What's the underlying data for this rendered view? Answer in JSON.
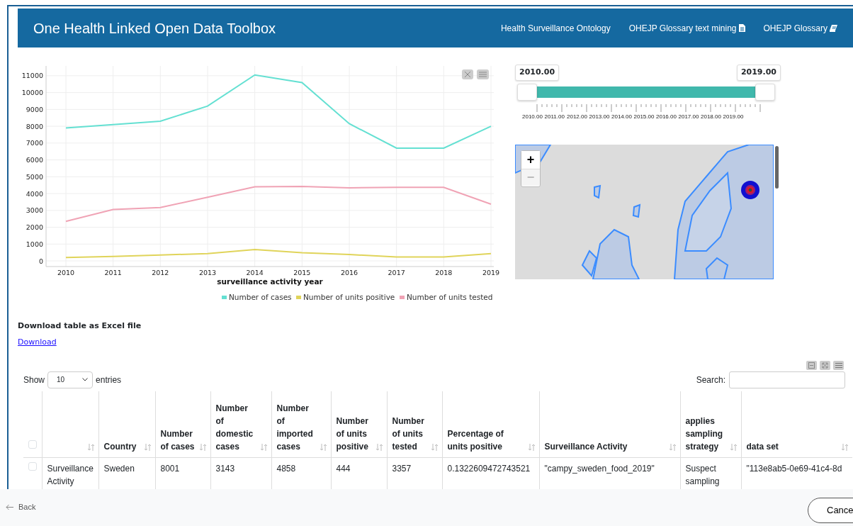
{
  "header": {
    "title": "One Health Linked Open Data Toolbox",
    "links": [
      {
        "label": "Health Surveillance Ontology",
        "kind": "plain"
      },
      {
        "label": "OHEJP Glossary text mining",
        "kind": "document"
      },
      {
        "label": "OHEJP Glossary",
        "kind": "book"
      }
    ]
  },
  "chart": {
    "chart_data": {
      "type": "line",
      "xlabel": "surveillance activity year",
      "grid": true,
      "legend": true,
      "categories": [
        "2010",
        "2011",
        "2012",
        "2013",
        "2014",
        "2015",
        "2016",
        "2017",
        "2018",
        "2019"
      ],
      "yticks": [
        0,
        1000,
        2000,
        3000,
        4000,
        5000,
        6000,
        7000,
        8000,
        9000,
        10000,
        11000
      ],
      "ylim": [
        0,
        11500
      ],
      "series": [
        {
          "name": "Number of cases",
          "color": "#64e0d2",
          "values": [
            7900,
            8100,
            8300,
            9200,
            11050,
            10600,
            8150,
            6700,
            6700,
            8000
          ]
        },
        {
          "name": "Number of units positive",
          "color": "#e0d45a",
          "values": [
            200,
            260,
            350,
            430,
            680,
            480,
            380,
            230,
            230,
            430
          ]
        },
        {
          "name": "Number of units tested",
          "color": "#f0a3b5",
          "values": [
            2350,
            3050,
            3170,
            3780,
            4400,
            4420,
            4340,
            4370,
            4370,
            3370
          ]
        }
      ]
    }
  },
  "slider": {
    "start": {
      "label": "2010.00"
    },
    "end": {
      "label": "2019.00"
    },
    "tick_labels": [
      "2010.00",
      "2011.00",
      "2012.00",
      "2013.00",
      "2014.00",
      "2015.00",
      "2016.00",
      "2017.00",
      "2018.00",
      "2019.00"
    ]
  },
  "map": {
    "zoom_in": {
      "label": "+",
      "disabled": false
    },
    "zoom_out": {
      "label": "−",
      "disabled": true
    }
  },
  "download": {
    "heading": "Download table as Excel file",
    "link": "Download"
  },
  "table": {
    "show_label": "Show",
    "page_size": "10",
    "entries_label": "entries",
    "search_label": "Search:",
    "header_checked": false,
    "columns": [
      "",
      "Country",
      "Number of cases",
      "Number of domestic cases",
      "Number of imported cases",
      "Number of units positive",
      "Number of units tested",
      "Percentage of units positive",
      "Surveillance Activity",
      "applies sampling strategy",
      "data set"
    ],
    "rows": [
      {
        "selected": false,
        "cells": [
          "Surveillance Activity",
          "Sweden",
          "8001",
          "3143",
          "4858",
          "444",
          "3357",
          "0.1322609472743521",
          "\"campy_sweden_food_2019\"",
          "Suspect sampling",
          "\"113e8ab5-0e69-41c4-8d"
        ]
      }
    ]
  },
  "footer": {
    "back": "Back",
    "cancel": "Cance"
  }
}
